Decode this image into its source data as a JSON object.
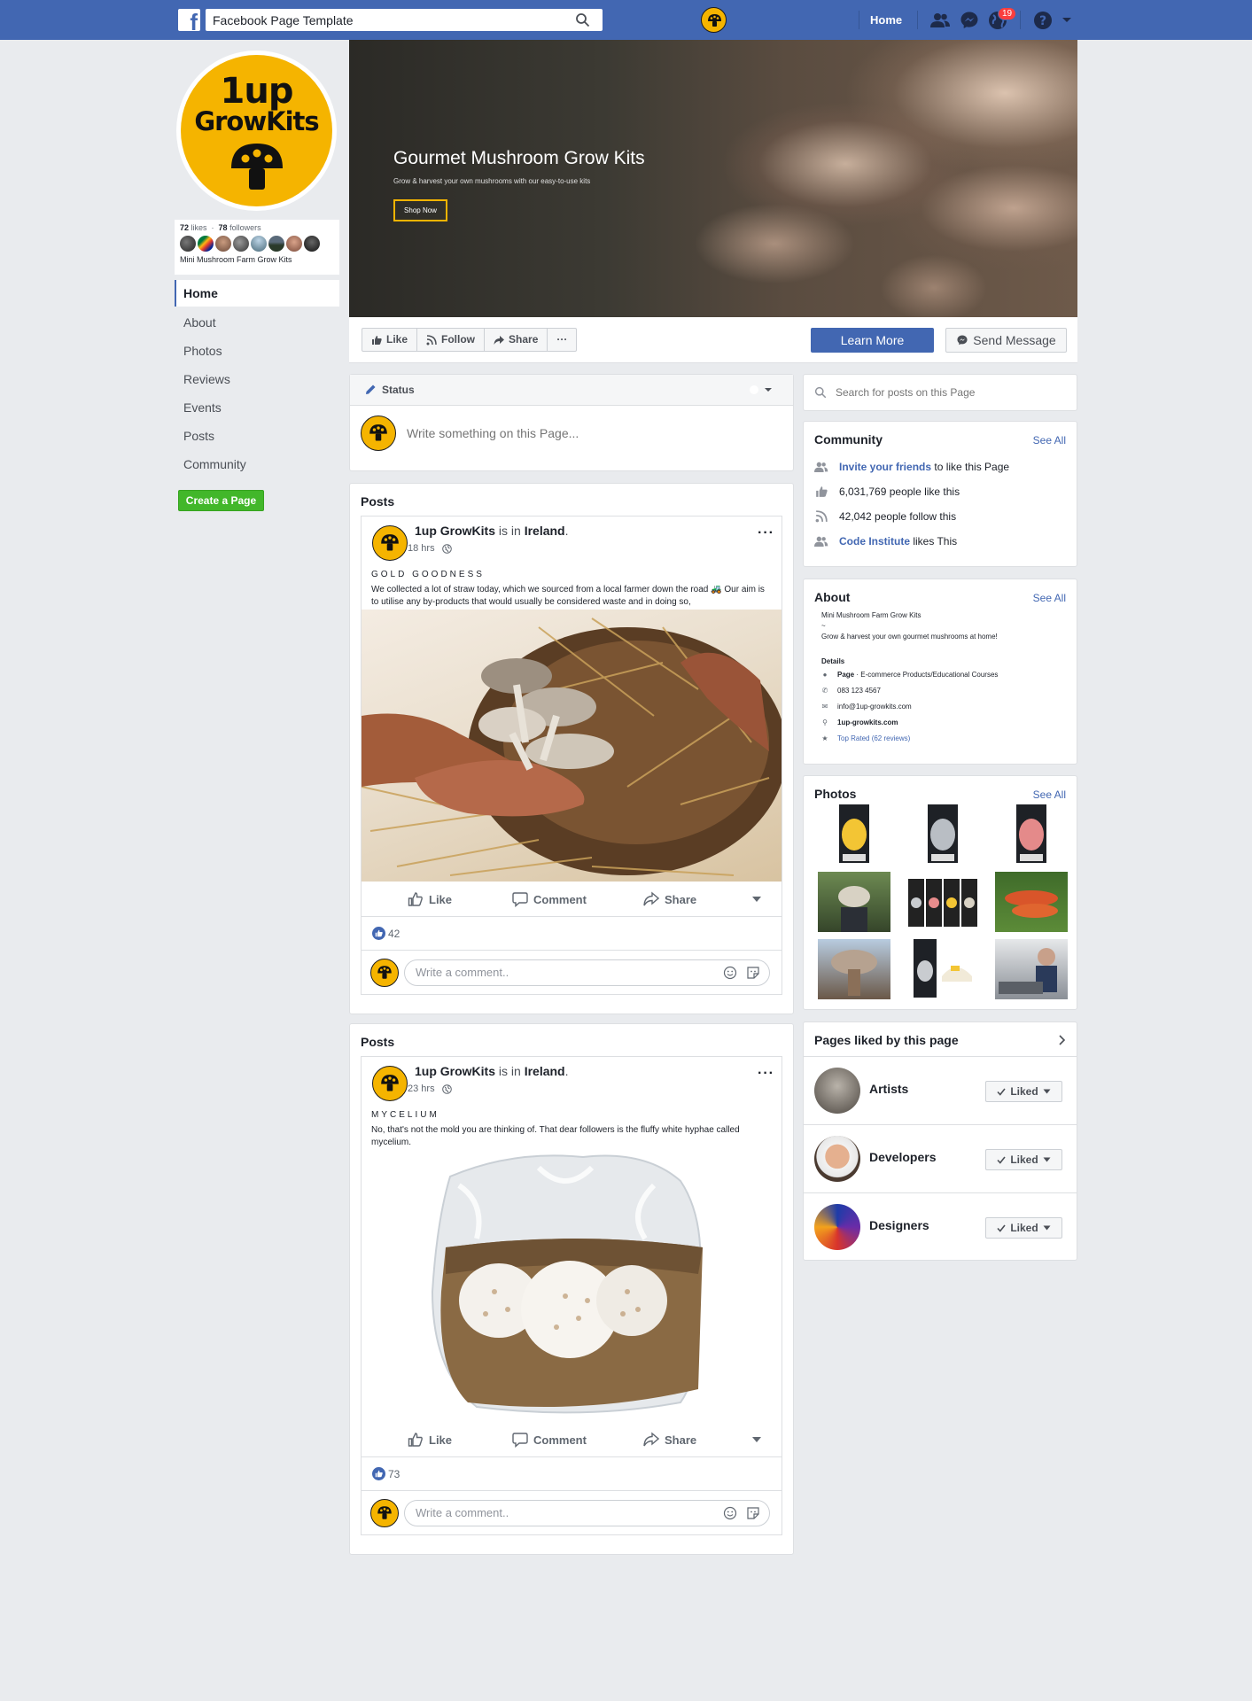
{
  "topbar": {
    "search_value": "Facebook Page Template",
    "home_label": "Home",
    "notification_count": "19"
  },
  "profile": {
    "logo_line1": "1up",
    "logo_line2": "GrowKits",
    "likes_count": "72",
    "likes_word": "likes",
    "followers_count": "78",
    "followers_word": "followers",
    "likes_subtitle": "Mini Mushroom Farm Grow Kits"
  },
  "leftnav": {
    "items": [
      {
        "label": "Home"
      },
      {
        "label": "About"
      },
      {
        "label": "Photos"
      },
      {
        "label": "Reviews"
      },
      {
        "label": "Events"
      },
      {
        "label": "Posts"
      },
      {
        "label": "Community"
      }
    ],
    "create_page_label": "Create a Page"
  },
  "cover": {
    "title": "Gourmet Mushroom Grow Kits",
    "subtitle": "Grow & harvest your own mushrooms with our easy-to-use kits",
    "shop_button": "Shop Now"
  },
  "actionbar": {
    "like": "Like",
    "follow": "Follow",
    "share": "Share",
    "more": "···",
    "learn_more": "Learn More",
    "send_message": "Send Message"
  },
  "status": {
    "label": "Status",
    "placeholder": "Write something on this Page..."
  },
  "posts": [
    {
      "section_title": "Posts",
      "author": "1up GrowKits",
      "is_in": "is in",
      "location": "Ireland",
      "period": ".",
      "time": "18 hrs",
      "heading": "GOLD GOODNESS",
      "text": "We collected a lot of straw today, which we sourced from a local farmer down the road 🚜 Our aim is to utilise any by-products that would usually be considered waste and in doing so,",
      "like_label": "Like",
      "comment_label": "Comment",
      "share_label": "Share",
      "likes_count": "42",
      "comment_placeholder": "Write a comment.."
    },
    {
      "section_title": "Posts",
      "author": "1up GrowKits",
      "is_in": "is in",
      "location": "Ireland",
      "period": ".",
      "time": "23 hrs",
      "heading": "MYCELIUM",
      "text": "No, that's not the mold you are thinking of. That dear followers is the fluffy white hyphae called mycelium.",
      "like_label": "Like",
      "comment_label": "Comment",
      "share_label": "Share",
      "likes_count": "73",
      "comment_placeholder": "Write a comment.."
    }
  ],
  "right": {
    "search_placeholder": "Search for posts on this Page",
    "community": {
      "title": "Community",
      "see_all": "See All",
      "invite_link": "Invite your friends",
      "invite_rest": " to like this Page",
      "likes": "6,031,769 people like this",
      "follows": "42,042 people follow this",
      "friend_link": "Code Institute",
      "friend_rest": " likes This"
    },
    "about": {
      "title": "About",
      "see_all": "See All",
      "line1": "Mini Mushroom Farm Grow Kits",
      "line2": "~",
      "line3": "Grow & harvest your own gourmet mushrooms at home!",
      "details_label": "Details",
      "page_bold": "Page",
      "page_rest": " · E-commerce Products/Educational Courses",
      "phone": "083 123 4567",
      "email": "info@1up-growkits.com",
      "website": "1up-growkits.com",
      "rating": "Top Rated (62 reviews)"
    },
    "photos": {
      "title": "Photos",
      "see_all": "See All"
    },
    "pages_liked": {
      "title": "Pages liked by this page",
      "items": [
        {
          "name": "Artists",
          "button": "Liked"
        },
        {
          "name": "Developers",
          "button": "Liked"
        },
        {
          "name": "Designers",
          "button": "Liked"
        }
      ]
    }
  },
  "colors": {
    "brand_blue": "#4267b2",
    "brand_yellow": "#f5b400",
    "create_green": "#42b72a",
    "page_bg": "#e9ebee"
  },
  "icons": [
    "facebook-logo-icon",
    "search-icon",
    "friends-icon",
    "messenger-icon",
    "globe-icon",
    "help-icon",
    "chevron-down-icon",
    "thumbs-up-icon",
    "rss-icon",
    "share-arrow-icon",
    "pencil-icon",
    "comment-icon",
    "smiley-icon",
    "sticker-icon",
    "info-icon",
    "envelope-icon",
    "link-icon",
    "star-icon",
    "checkmark-icon",
    "chevron-right-icon"
  ]
}
